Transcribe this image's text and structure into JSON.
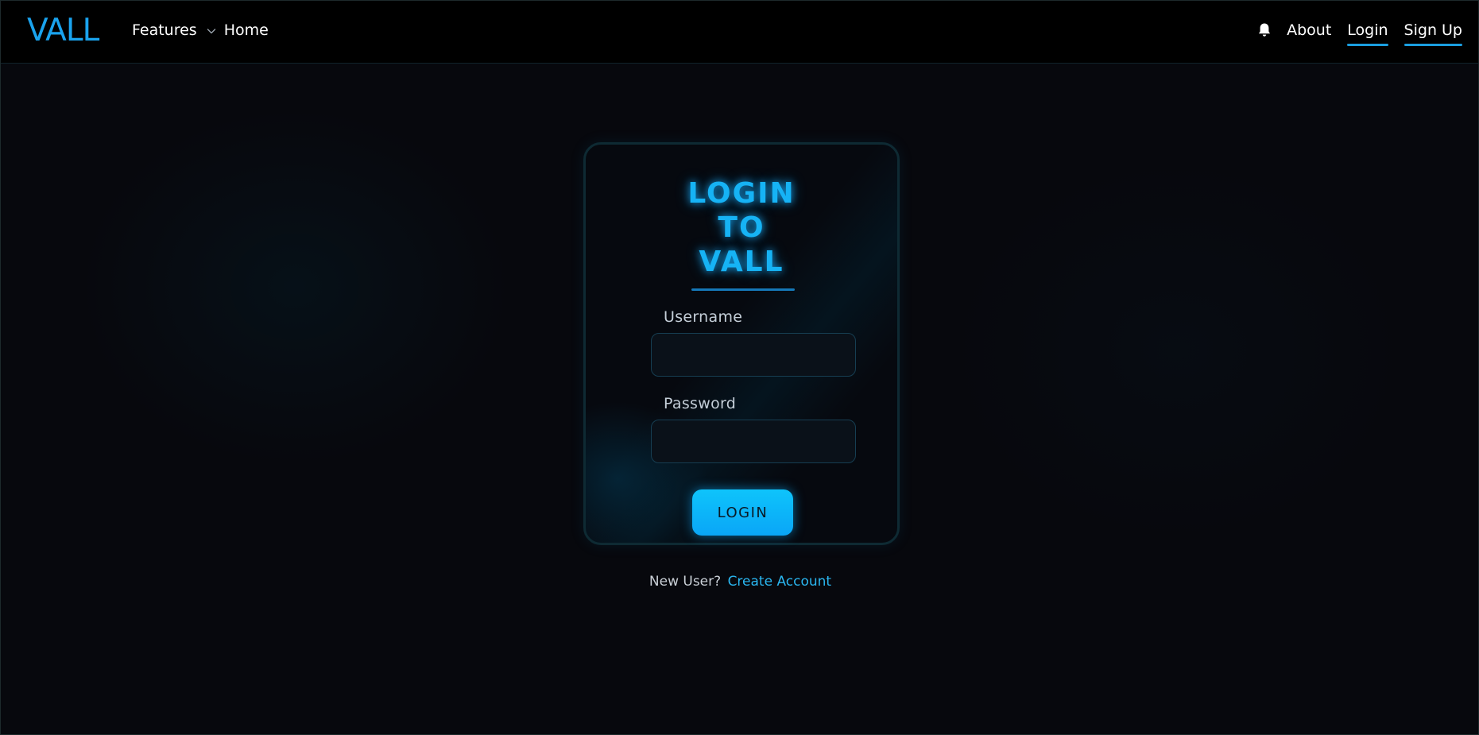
{
  "navbar": {
    "logo": "VALL",
    "features_label": "Features",
    "home_label": "Home",
    "about_label": "About",
    "login_label": "Login",
    "signup_label": "Sign Up",
    "icons": {
      "features_dropdown": "chevron-down-icon",
      "notifications": "bell-icon"
    }
  },
  "login_card": {
    "title_lines": [
      "LOGIN",
      "TO",
      "VALL"
    ],
    "username_label": "Username",
    "username_value": "",
    "password_label": "Password",
    "password_value": "",
    "submit_label": "LOGIN"
  },
  "footer_prompt": {
    "question": "New User?",
    "link_label": "Create Account"
  },
  "colors": {
    "accent": "#16b3f5",
    "button": "#0ec4fb",
    "background": "#07080d",
    "navbar": "#000000"
  }
}
